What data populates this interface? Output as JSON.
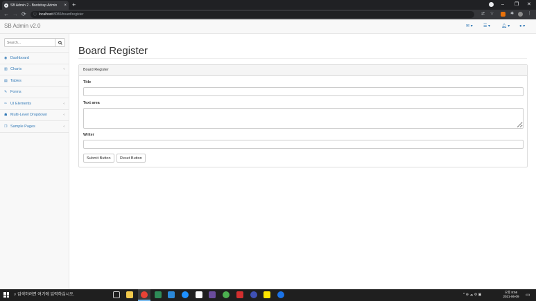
{
  "browser": {
    "tab_title": "SB Admin 2 - Bootstrap Admin",
    "url_host": "localhost",
    "url_path": ":8080/board/register"
  },
  "navbar": {
    "brand": "SB Admin v2.0"
  },
  "sidebar": {
    "search_placeholder": "Search...",
    "items": [
      {
        "label": "Dashboard",
        "icon": "dashboard-icon",
        "has_arrow": false
      },
      {
        "label": "Charts",
        "icon": "bar-chart-icon",
        "has_arrow": true
      },
      {
        "label": "Tables",
        "icon": "table-icon",
        "has_arrow": false
      },
      {
        "label": "Forms",
        "icon": "edit-icon",
        "has_arrow": false
      },
      {
        "label": "UI Elements",
        "icon": "wrench-icon",
        "has_arrow": true
      },
      {
        "label": "Multi-Level Dropdown",
        "icon": "sitemap-icon",
        "has_arrow": true
      },
      {
        "label": "Sample Pages",
        "icon": "files-icon",
        "has_arrow": true
      }
    ]
  },
  "main": {
    "page_title": "Board Register",
    "panel_heading": "Board Register",
    "title_label": "Title",
    "textarea_label": "Text area",
    "writer_label": "Writer",
    "submit_label": "Submit Button",
    "reset_label": "Reset Button"
  },
  "taskbar": {
    "search_text": "검색하려면 여기에 입력하십시오.",
    "time": "오후 8:56",
    "date": "2021-06-09"
  },
  "colors": {
    "link": "#337ab7",
    "navbar_bg": "#f8f8f8",
    "panel_heading_bg": "#f5f5f5"
  }
}
